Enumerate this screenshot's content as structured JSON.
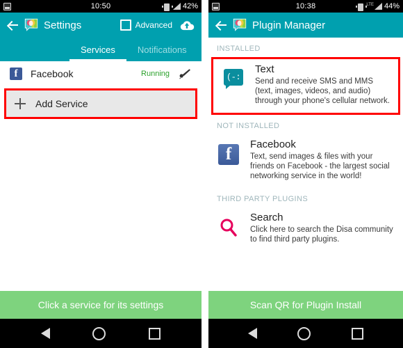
{
  "left_phone": {
    "status_bar": {
      "image_icon": "image-icon",
      "time": "10:50",
      "vibrate_icon": "vibrate-icon",
      "network_type": "",
      "signal_icon": "signal-icon",
      "battery": "42%"
    },
    "app_bar": {
      "back_icon": "back-arrow-icon",
      "logo_icon": "disa-logo-icon",
      "title": "Settings",
      "advanced_label": "Advanced",
      "advanced_checked": false,
      "cloud_icon": "cloud-upload-icon"
    },
    "tabs": [
      {
        "label": "Services",
        "active": true
      },
      {
        "label": "Notifications",
        "active": false
      }
    ],
    "services": [
      {
        "icon": "facebook-icon",
        "name": "Facebook",
        "status": "Running",
        "edit_icon": "brush-icon"
      }
    ],
    "add_service": {
      "plus_icon": "plus-icon",
      "label": "Add Service",
      "highlighted": true
    },
    "bottom_bar": {
      "label": "Click a service for its settings"
    },
    "nav_bar": {
      "back": "nav-back-icon",
      "home": "nav-home-icon",
      "recents": "nav-recents-icon"
    }
  },
  "right_phone": {
    "status_bar": {
      "image_icon": "image-icon",
      "time": "10:38",
      "vibrate_icon": "vibrate-icon",
      "network_type": "LTE",
      "signal_icon": "signal-icon",
      "battery": "44%"
    },
    "app_bar": {
      "back_icon": "back-arrow-icon",
      "logo_icon": "disa-logo-icon",
      "title": "Plugin Manager"
    },
    "sections": [
      {
        "heading": "INSTALLED",
        "plugins": [
          {
            "icon": "sms-bubble-icon",
            "title": "Text",
            "description": "Send and receive SMS and MMS (text, images, videos, and audio) through your phone's cellular network.",
            "highlighted": true
          }
        ]
      },
      {
        "heading": "NOT INSTALLED",
        "plugins": [
          {
            "icon": "facebook-icon",
            "title": "Facebook",
            "description": "Text, send images & files with your friends on Facebook - the largest social networking service in the world!",
            "highlighted": false
          }
        ]
      },
      {
        "heading": "THIRD PARTY PLUGINS",
        "plugins": [
          {
            "icon": "search-icon",
            "title": "Search",
            "description": "Click here to search the Disa community to find third party plugins.",
            "highlighted": false
          }
        ]
      }
    ],
    "bottom_bar": {
      "label": "Scan QR for Plugin Install"
    },
    "nav_bar": {
      "back": "nav-back-icon",
      "home": "nav-home-icon",
      "recents": "nav-recents-icon"
    }
  },
  "colors": {
    "appbar_teal": "#00A0AF",
    "green_bar": "#7ed37e",
    "highlight_red": "#ff0000",
    "running_green": "#2aa02a",
    "facebook_blue": "#3b5998",
    "sms_teal": "#0a8e9e",
    "search_pink": "#e6005c",
    "section_heading": "#9fb6bb"
  }
}
